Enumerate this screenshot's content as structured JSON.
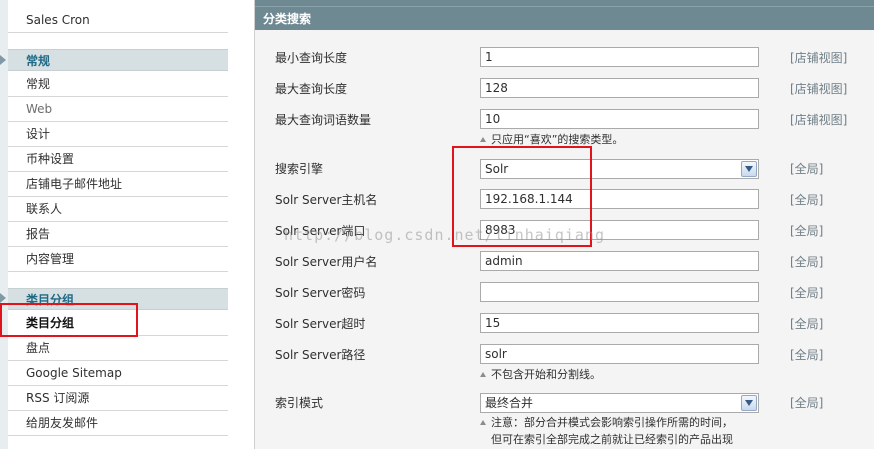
{
  "sidebar": {
    "top_item": "Sales Cron",
    "group1_header": "常规",
    "group1_items": [
      "常规",
      "Web",
      "设计",
      "币种设置",
      "店铺电子邮件地址",
      "联系人",
      "报告",
      "内容管理"
    ],
    "group2_header": "类目分组",
    "group2_items": [
      "类目分组",
      "盘点",
      "Google Sitemap",
      "RSS 订阅源",
      "给朋友发邮件"
    ]
  },
  "section": {
    "title": "分类搜索"
  },
  "fields": [
    {
      "label": "最小查询长度",
      "value": "1",
      "scope": "[店铺视图]"
    },
    {
      "label": "最大查询长度",
      "value": "128",
      "scope": "[店铺视图]"
    },
    {
      "label": "最大查询词语数量",
      "value": "10",
      "scope": "[店铺视图]",
      "note": "只应用“喜欢”的搜索类型。"
    },
    {
      "label": "搜索引擎",
      "value": "Solr",
      "scope": "[全局]"
    },
    {
      "label": "Solr Server主机名",
      "value": "192.168.1.144",
      "scope": "[全局]"
    },
    {
      "label": "Solr Server端口",
      "value": "8983",
      "scope": "[全局]"
    },
    {
      "label": "Solr Server用户名",
      "value": "admin",
      "scope": "[全局]"
    },
    {
      "label": "Solr Server密码",
      "value": "",
      "scope": "[全局]"
    },
    {
      "label": "Solr Server超时",
      "value": "15",
      "scope": "[全局]"
    },
    {
      "label": "Solr Server路径",
      "value": "solr",
      "scope": "[全局]",
      "note": "不包含开始和分割线。"
    },
    {
      "label": "索引模式",
      "value": "最终合并",
      "scope": "[全局]",
      "note": "注意：部分合并模式会影响索引操作所需的时间，",
      "note2": "但可在索引全部完成之前就让已经索引的产品出现"
    }
  ],
  "watermark": "http://blog.csdn.net/linhaiqiang",
  "colors": {
    "header_bg": "#6f8992",
    "sidebar_header_bg": "#d6e0e3",
    "highlight": "#e0141a"
  }
}
